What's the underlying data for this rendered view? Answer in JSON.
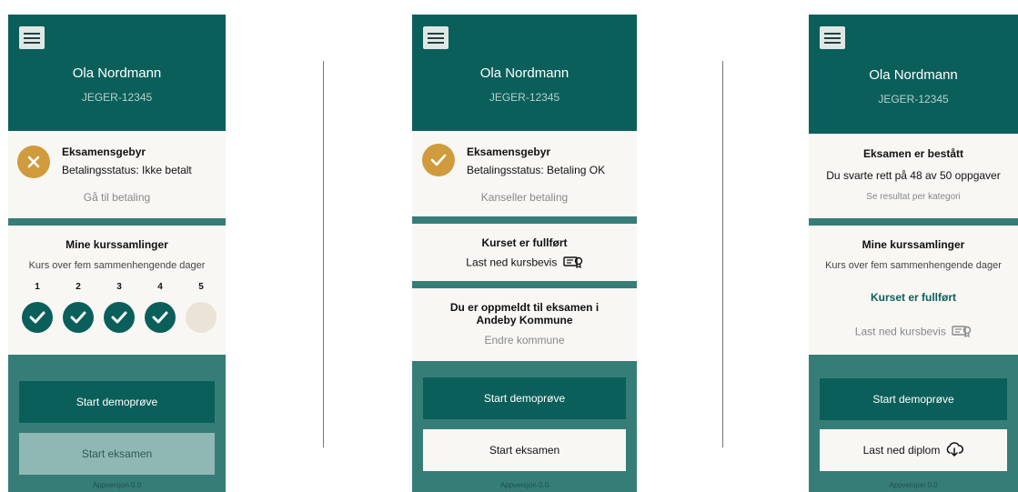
{
  "user": {
    "name": "Ola Nordmann",
    "id": "JEGER-12345"
  },
  "app_version": "Appversjon 0.0",
  "screen1": {
    "fee_title": "Eksamensgebyr",
    "fee_status": "Betalingsstatus: Ikke betalt",
    "fee_link": "Gå til betaling",
    "courses_title": "Mine kurssamlinger",
    "courses_desc": "Kurs over fem sammenhengende dager",
    "steps": [
      "1",
      "2",
      "3",
      "4",
      "5"
    ],
    "steps_completed": 4,
    "btn_demo": "Start demoprøve",
    "btn_exam": "Start eksamen"
  },
  "screen2": {
    "fee_title": "Eksamensgebyr",
    "fee_status": "Betalingsstatus: Betaling OK",
    "fee_link": "Kanseller betaling",
    "course_done": "Kurset er fullført",
    "download_cert": "Last ned kursbevis",
    "exam_registered": "Du er oppmeldt til eksamen i Andeby Kommune",
    "change_municipality": "Endre kommune",
    "btn_demo": "Start demoprøve",
    "btn_exam": "Start eksamen"
  },
  "screen3": {
    "exam_passed": "Eksamen er bestått",
    "score": "Du svarte rett på 48 av 50 oppgaver",
    "results_link": "Se resultat per kategori",
    "courses_title": "Mine kurssamlinger",
    "courses_desc": "Kurs over fem sammenhengende dager",
    "course_done": "Kurset er fullført",
    "download_cert": "Last ned kursbevis",
    "btn_demo": "Start demoprøve",
    "btn_diploma": "Last ned diplom"
  },
  "colors": {
    "header": "#0b5f5b",
    "body": "#367d78",
    "card": "#f8f7f3",
    "warning": "#cf9b3c"
  },
  "icons": [
    "hamburger-menu-icon",
    "x-icon",
    "check-icon",
    "certificate-icon",
    "cloud-download-icon"
  ]
}
